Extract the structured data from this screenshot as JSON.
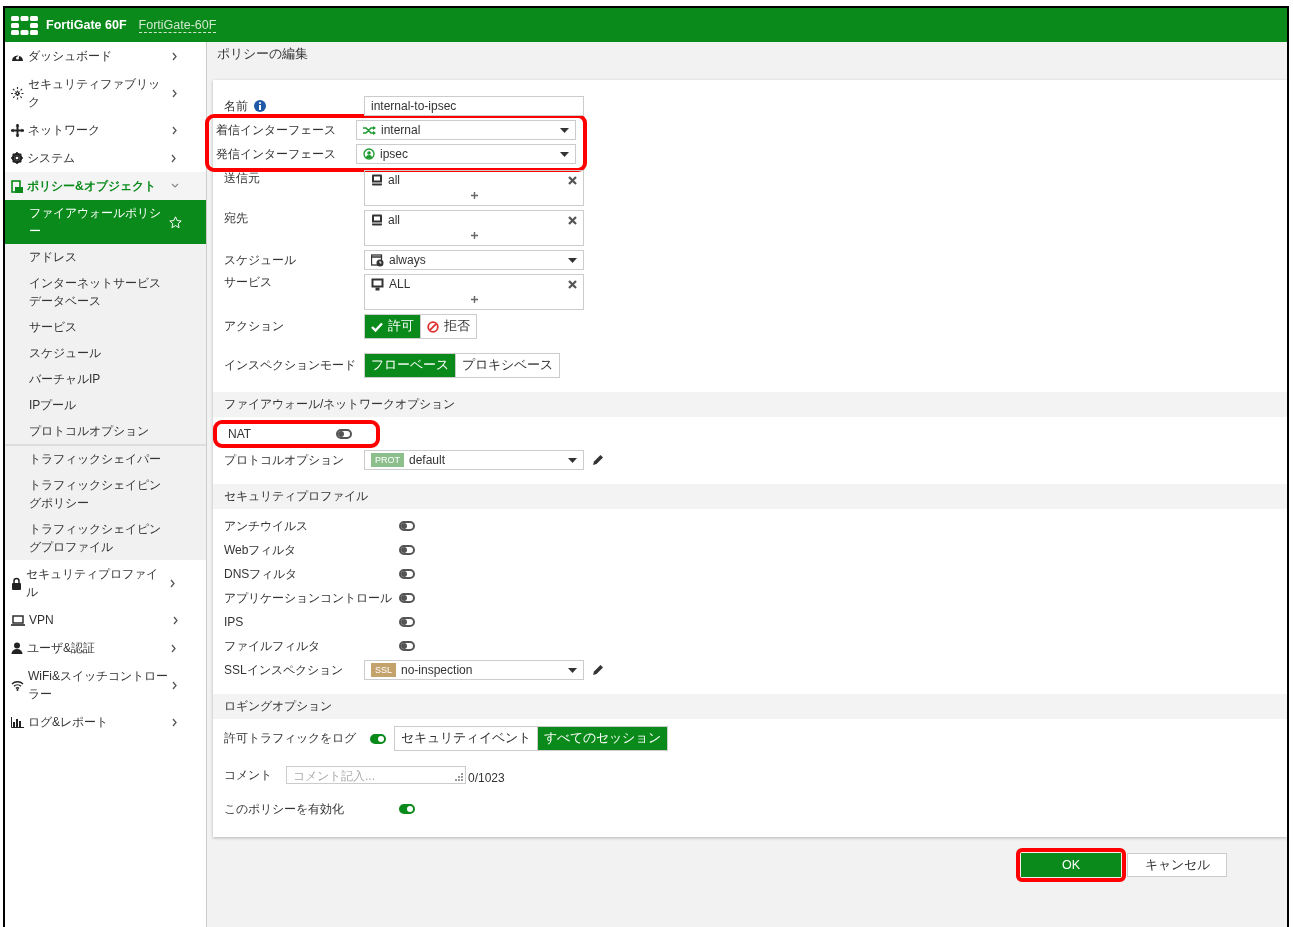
{
  "header": {
    "product": "FortiGate 60F",
    "hostname": "FortiGate-60F"
  },
  "sidebar": {
    "items": [
      {
        "label": "ダッシュボード",
        "expanded": false
      },
      {
        "label": "セキュリティファブリック",
        "expanded": false
      },
      {
        "label": "ネットワーク",
        "expanded": false
      },
      {
        "label": "システム",
        "expanded": false
      },
      {
        "label": "ポリシー&オブジェクト",
        "expanded": true,
        "children": [
          {
            "label": "ファイアウォールポリシー",
            "selected": true,
            "separator_before": false
          },
          {
            "label": "アドレス",
            "selected": false,
            "separator_before": false
          },
          {
            "label": "インターネットサービスデータベース",
            "selected": false,
            "separator_before": false
          },
          {
            "label": "サービス",
            "selected": false,
            "separator_before": false
          },
          {
            "label": "スケジュール",
            "selected": false,
            "separator_before": false
          },
          {
            "label": "バーチャルIP",
            "selected": false,
            "separator_before": false
          },
          {
            "label": "IPプール",
            "selected": false,
            "separator_before": false
          },
          {
            "label": "プロトコルオプション",
            "selected": false,
            "separator_before": false
          },
          {
            "label": "トラフィックシェイパー",
            "selected": false,
            "separator_before": true
          },
          {
            "label": "トラフィックシェイピングポリシー",
            "selected": false,
            "separator_before": false
          },
          {
            "label": "トラフィックシェイピングプロファイル",
            "selected": false,
            "separator_before": false
          }
        ]
      },
      {
        "label": "セキュリティプロファイル",
        "expanded": false
      },
      {
        "label": "VPN",
        "expanded": false
      },
      {
        "label": "ユーザ&認証",
        "expanded": false
      },
      {
        "label": "WiFi&スイッチコントローラー",
        "expanded": false
      },
      {
        "label": "ログ&レポート",
        "expanded": false
      }
    ]
  },
  "page_title": "ポリシーの編集",
  "form": {
    "rows": [
      {
        "kind": "text",
        "label": "名前",
        "value": "internal-to-ipsec"
      },
      {
        "kind": "group",
        "highlighted": true,
        "rows": [
          {
            "kind": "select",
            "label": "着信インターフェース",
            "value": "internal"
          },
          {
            "kind": "select",
            "label": "発信インターフェース",
            "value": "ipsec"
          }
        ]
      },
      {
        "kind": "multi",
        "label": "送信元",
        "value": "all"
      },
      {
        "kind": "multi",
        "label": "宛先",
        "value": "all"
      },
      {
        "kind": "select",
        "label": "スケジュール",
        "value": "always"
      },
      {
        "kind": "multi",
        "label": "サービス",
        "value": "ALL"
      },
      {
        "kind": "segmented",
        "label": "アクション",
        "options": [
          {
            "label": "許可",
            "selected": true
          },
          {
            "label": "拒否",
            "selected": false
          }
        ]
      },
      {
        "kind": "segmented",
        "label": "インスペクションモード",
        "options": [
          {
            "label": "フローベース",
            "selected": true
          },
          {
            "label": "プロキシベース",
            "selected": false
          }
        ]
      },
      {
        "kind": "section",
        "label": "ファイアウォール/ネットワークオプション"
      },
      {
        "kind": "toggle",
        "label": "NAT",
        "on": false,
        "highlighted": true
      },
      {
        "kind": "badge-select",
        "label": "プロトコルオプション",
        "badge": "PROT",
        "color": "#8dbf8d",
        "value": "default"
      },
      {
        "kind": "section",
        "label": "セキュリティプロファイル"
      },
      {
        "kind": "toggle",
        "label": "アンチウイルス",
        "on": false,
        "highlighted": false
      },
      {
        "kind": "toggle",
        "label": "Webフィルタ",
        "on": false,
        "highlighted": false
      },
      {
        "kind": "toggle",
        "label": "DNSフィルタ",
        "on": false,
        "highlighted": false
      },
      {
        "kind": "toggle",
        "label": "アプリケーションコントロール",
        "on": false,
        "highlighted": false
      },
      {
        "kind": "toggle",
        "label": "IPS",
        "on": false,
        "highlighted": false
      },
      {
        "kind": "toggle",
        "label": "ファイルフィルタ",
        "on": false,
        "highlighted": false
      },
      {
        "kind": "badge-select",
        "label": "SSLインスペクション",
        "badge": "SSL",
        "color": "#c4a26c",
        "value": "no-inspection"
      },
      {
        "kind": "section",
        "label": "ロギングオプション"
      },
      {
        "kind": "toggle-segmented",
        "label": "許可トラフィックをログ",
        "on": true,
        "options": [
          {
            "label": "セキュリティイベント",
            "selected": false
          },
          {
            "label": "すべてのセッション",
            "selected": true
          }
        ]
      },
      {
        "kind": "comment",
        "label": "コメント",
        "placeholder": "コメント記入...",
        "counter": "0/1023"
      },
      {
        "kind": "toggle",
        "label": "このポリシーを有効化",
        "on": true,
        "highlighted": false
      }
    ]
  },
  "buttons": [
    {
      "label": "OK",
      "kind": "primary",
      "highlighted": true
    },
    {
      "label": "キャンセル",
      "kind": "secondary",
      "highlighted": false
    }
  ]
}
